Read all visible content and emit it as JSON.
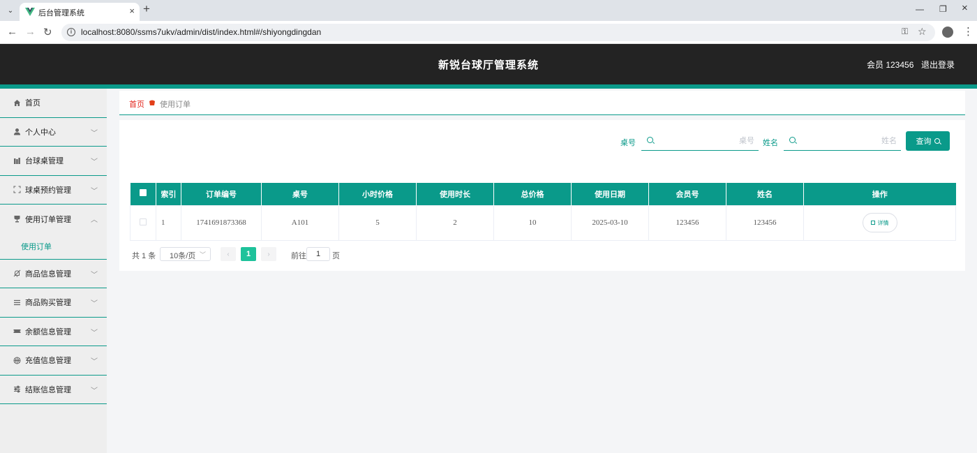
{
  "browser": {
    "tab_title": "后台管理系统",
    "url": "localhost:8080/ssms7ukv/admin/dist/index.html#/shiyongdingdan"
  },
  "header": {
    "title": "新锐台球厅管理系统",
    "user": "会员 123456",
    "logout": "退出登录"
  },
  "sidebar": {
    "items": [
      {
        "label": "首页",
        "icon": "home-icon"
      },
      {
        "label": "个人中心",
        "icon": "user-icon"
      },
      {
        "label": "台球桌管理",
        "icon": "table-icon"
      },
      {
        "label": "球桌预约管理",
        "icon": "fullscreen-icon"
      },
      {
        "label": "使用订单管理",
        "icon": "goblet-icon"
      },
      {
        "label": "商品信息管理",
        "icon": "bell-off-icon"
      },
      {
        "label": "商品购买管理",
        "icon": "list-icon"
      },
      {
        "label": "余额信息管理",
        "icon": "ticket-icon"
      },
      {
        "label": "充值信息管理",
        "icon": "basketball-icon"
      },
      {
        "label": "结账信息管理",
        "icon": "sliders-icon"
      }
    ],
    "submenu": {
      "label": "使用订单"
    }
  },
  "breadcrumb": {
    "home": "首页",
    "current": "使用订单"
  },
  "search": {
    "desk_label": "桌号",
    "desk_placeholder": "桌号",
    "name_label": "姓名",
    "name_placeholder": "姓名",
    "button": "查询"
  },
  "table": {
    "headers": [
      "索引",
      "订单编号",
      "桌号",
      "小时价格",
      "使用时长",
      "总价格",
      "使用日期",
      "会员号",
      "姓名",
      "操作"
    ],
    "rows": [
      {
        "index": "1",
        "order_no": "1741691873368",
        "desk": "A101",
        "hour_price": "5",
        "duration": "2",
        "total": "10",
        "date": "2025-03-10",
        "member_no": "123456",
        "name": "123456",
        "action": "详情"
      }
    ]
  },
  "pagination": {
    "total": "共 1 条",
    "page_size": "10条/页",
    "current_page": "1",
    "goto_label": "前往",
    "goto_value": "1",
    "page_unit": "页"
  },
  "colors": {
    "accent": "#0a9a8a",
    "header_bg": "#232323",
    "breadcrumb_home": "#e2231a",
    "active_page": "#1ec29b"
  }
}
